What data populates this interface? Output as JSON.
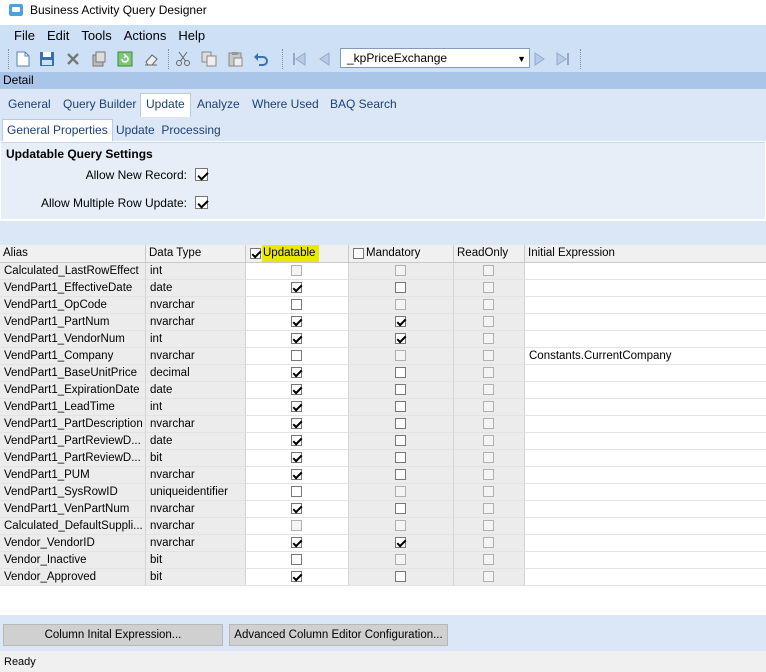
{
  "window": {
    "title": "Business Activity Query Designer"
  },
  "menu": [
    "File",
    "Edit",
    "Tools",
    "Actions",
    "Help"
  ],
  "toolbar": {
    "icons": [
      "new-icon",
      "save-icon",
      "delete-icon",
      "attach-icon",
      "refresh-icon",
      "eraser-icon",
      "cut-icon",
      "copy-icon",
      "paste-icon",
      "undo-icon",
      "first-record-icon",
      "prev-record-icon",
      "next-record-icon",
      "last-record-icon"
    ],
    "record_selector": "_kpPriceExchange"
  },
  "detail_label": "Detail",
  "tabs": [
    "General",
    "Query Builder",
    "Update",
    "Analyze",
    "Where Used",
    "BAQ Search"
  ],
  "active_tab": "Update",
  "subtabs": [
    "General Properties",
    "Update  Processing"
  ],
  "active_subtab": "General Properties",
  "settings": {
    "header": "Updatable Query Settings",
    "allow_new_record_label": "Allow New Record:",
    "allow_new_record": true,
    "allow_multiple_row_label": "Allow Multiple Row Update:",
    "allow_multiple_row": true
  },
  "grid": {
    "columns": {
      "alias": "Alias",
      "data_type": "Data Type",
      "updatable": "Updatable",
      "mandatory": "Mandatory",
      "readonly": "ReadOnly",
      "initial_expression": "Initial Expression"
    },
    "updatable_header_checked": true,
    "mandatory_header_checked": false,
    "highlight_color": "#eaea00",
    "rows": [
      {
        "alias": "Calculated_LastRowEffect",
        "type": "int",
        "updatable": false,
        "mandatory": false,
        "readonly": false,
        "expr": "",
        "upd_enabled": false
      },
      {
        "alias": "VendPart1_EffectiveDate",
        "type": "date",
        "updatable": true,
        "mandatory": false,
        "readonly": false,
        "expr": "",
        "upd_enabled": true
      },
      {
        "alias": "VendPart1_OpCode",
        "type": "nvarchar",
        "updatable": false,
        "mandatory": false,
        "readonly": false,
        "expr": "",
        "upd_enabled": true
      },
      {
        "alias": "VendPart1_PartNum",
        "type": "nvarchar",
        "updatable": true,
        "mandatory": true,
        "readonly": false,
        "expr": "",
        "upd_enabled": true
      },
      {
        "alias": "VendPart1_VendorNum",
        "type": "int",
        "updatable": true,
        "mandatory": true,
        "readonly": false,
        "expr": "",
        "upd_enabled": true
      },
      {
        "alias": "VendPart1_Company",
        "type": "nvarchar",
        "updatable": false,
        "mandatory": false,
        "readonly": false,
        "expr": "Constants.CurrentCompany",
        "upd_enabled": true
      },
      {
        "alias": "VendPart1_BaseUnitPrice",
        "type": "decimal",
        "updatable": true,
        "mandatory": false,
        "readonly": false,
        "expr": "",
        "upd_enabled": true
      },
      {
        "alias": "VendPart1_ExpirationDate",
        "type": "date",
        "updatable": true,
        "mandatory": false,
        "readonly": false,
        "expr": "",
        "upd_enabled": true
      },
      {
        "alias": "VendPart1_LeadTime",
        "type": "int",
        "updatable": true,
        "mandatory": false,
        "readonly": false,
        "expr": "",
        "upd_enabled": true
      },
      {
        "alias": "VendPart1_PartDescription",
        "type": "nvarchar",
        "updatable": true,
        "mandatory": false,
        "readonly": false,
        "expr": "",
        "upd_enabled": true
      },
      {
        "alias": "VendPart1_PartReviewD...",
        "type": "date",
        "updatable": true,
        "mandatory": false,
        "readonly": false,
        "expr": "",
        "upd_enabled": true
      },
      {
        "alias": "VendPart1_PartReviewD...",
        "type": "bit",
        "updatable": true,
        "mandatory": false,
        "readonly": false,
        "expr": "",
        "upd_enabled": true
      },
      {
        "alias": "VendPart1_PUM",
        "type": "nvarchar",
        "updatable": true,
        "mandatory": false,
        "readonly": false,
        "expr": "",
        "upd_enabled": true
      },
      {
        "alias": "VendPart1_SysRowID",
        "type": "uniqueidentifier",
        "updatable": false,
        "mandatory": false,
        "readonly": false,
        "expr": "",
        "upd_enabled": true
      },
      {
        "alias": "VendPart1_VenPartNum",
        "type": "nvarchar",
        "updatable": true,
        "mandatory": false,
        "readonly": false,
        "expr": "",
        "upd_enabled": true
      },
      {
        "alias": "Calculated_DefaultSuppli...",
        "type": "nvarchar",
        "updatable": false,
        "mandatory": false,
        "readonly": false,
        "expr": "",
        "upd_enabled": false
      },
      {
        "alias": "Vendor_VendorID",
        "type": "nvarchar",
        "updatable": true,
        "mandatory": true,
        "readonly": false,
        "expr": "",
        "upd_enabled": true
      },
      {
        "alias": "Vendor_Inactive",
        "type": "bit",
        "updatable": false,
        "mandatory": false,
        "readonly": false,
        "expr": "",
        "upd_enabled": true
      },
      {
        "alias": "Vendor_Approved",
        "type": "bit",
        "updatable": true,
        "mandatory": false,
        "readonly": false,
        "expr": "",
        "upd_enabled": true
      }
    ]
  },
  "buttons": {
    "column_initial_expression": "Column Inital Expression...",
    "advanced_column_editor": "Advanced Column Editor Configuration..."
  },
  "status": "Ready"
}
